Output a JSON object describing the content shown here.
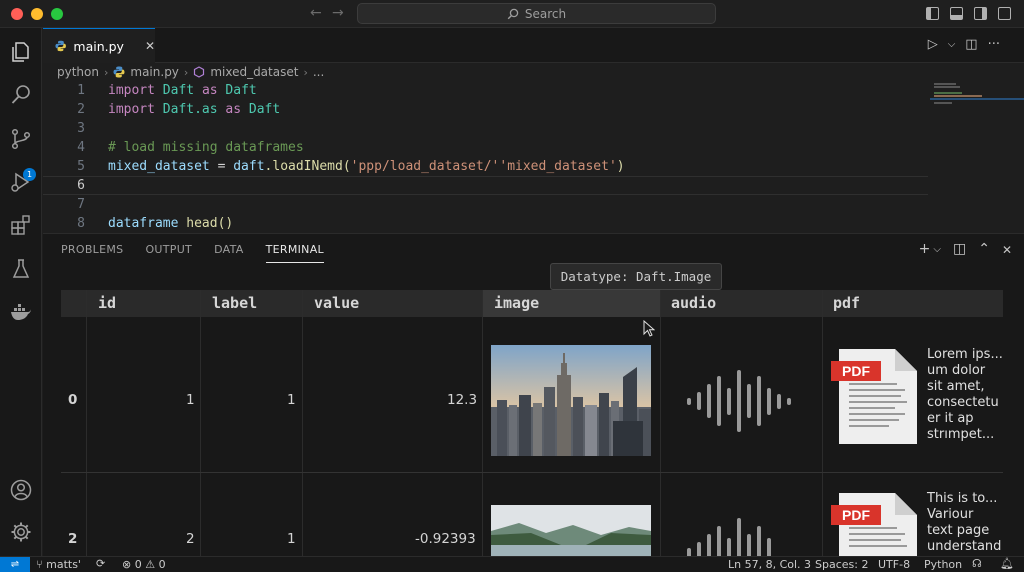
{
  "titlebar": {
    "search_label": "Search"
  },
  "tab": {
    "label": "main.py"
  },
  "breadcrumb": [
    "python",
    "main.py",
    "mixed_dataset",
    "..."
  ],
  "editor": {
    "line_numbers": [
      "1",
      "2",
      "3",
      "4",
      "5",
      "6",
      "7",
      "8"
    ],
    "comment": "# load missing dataframes",
    "line1": {
      "kw": "import",
      "mod": "Daft",
      "as": "as",
      "alias": "Daft"
    },
    "line2": {
      "kw": "import",
      "mod": "Daft.as",
      "as": "as",
      "alias": "Daft"
    },
    "line5": {
      "var": "mixed_dataset",
      "eq": " = ",
      "obj": "daft",
      "fn": ".loadINemd",
      "open": "(",
      "s1": "'ppp/load_dataset/'",
      "s2": "'mixed_dataset'",
      "close": ")"
    },
    "line8": {
      "var": "dataframe",
      "fn": " head",
      "paren": "()"
    }
  },
  "panel": {
    "tabs": [
      "PROBLEMS",
      "OUTPUT",
      "DATA",
      "TERMINAL"
    ],
    "active_tab": "TERMINAL",
    "tooltip": "Datatype: Daft.Image"
  },
  "table": {
    "columns": [
      "id",
      "label",
      "value",
      "image",
      "audio",
      "pdf"
    ],
    "rows": [
      {
        "index": "0",
        "id": "1",
        "label": "1",
        "value": "12.3",
        "pdf_badge": "PDF",
        "pdf_text": [
          "Lorem ips...",
          "um dolor",
          "sit amet,",
          "consectetu",
          "er it ap",
          "strımpet..."
        ]
      },
      {
        "index": "2",
        "id": "2",
        "label": "1",
        "value": "-0.92393",
        "pdf_badge": "PDF",
        "pdf_text": [
          "This is to...",
          "Variour",
          "text page",
          "understand"
        ]
      }
    ]
  },
  "statusbar": {
    "branch": "matts'",
    "errors": "0",
    "warnings": "0",
    "position": "Ln 57, 8, Col. 3",
    "spaces": "Spaces: 2",
    "encoding": "UTF-8",
    "language": "Python"
  },
  "colors": {
    "accent": "#0078d4",
    "status_bar": "#181818",
    "remote": "#0078d4",
    "pdf_red": "#d9342b"
  }
}
